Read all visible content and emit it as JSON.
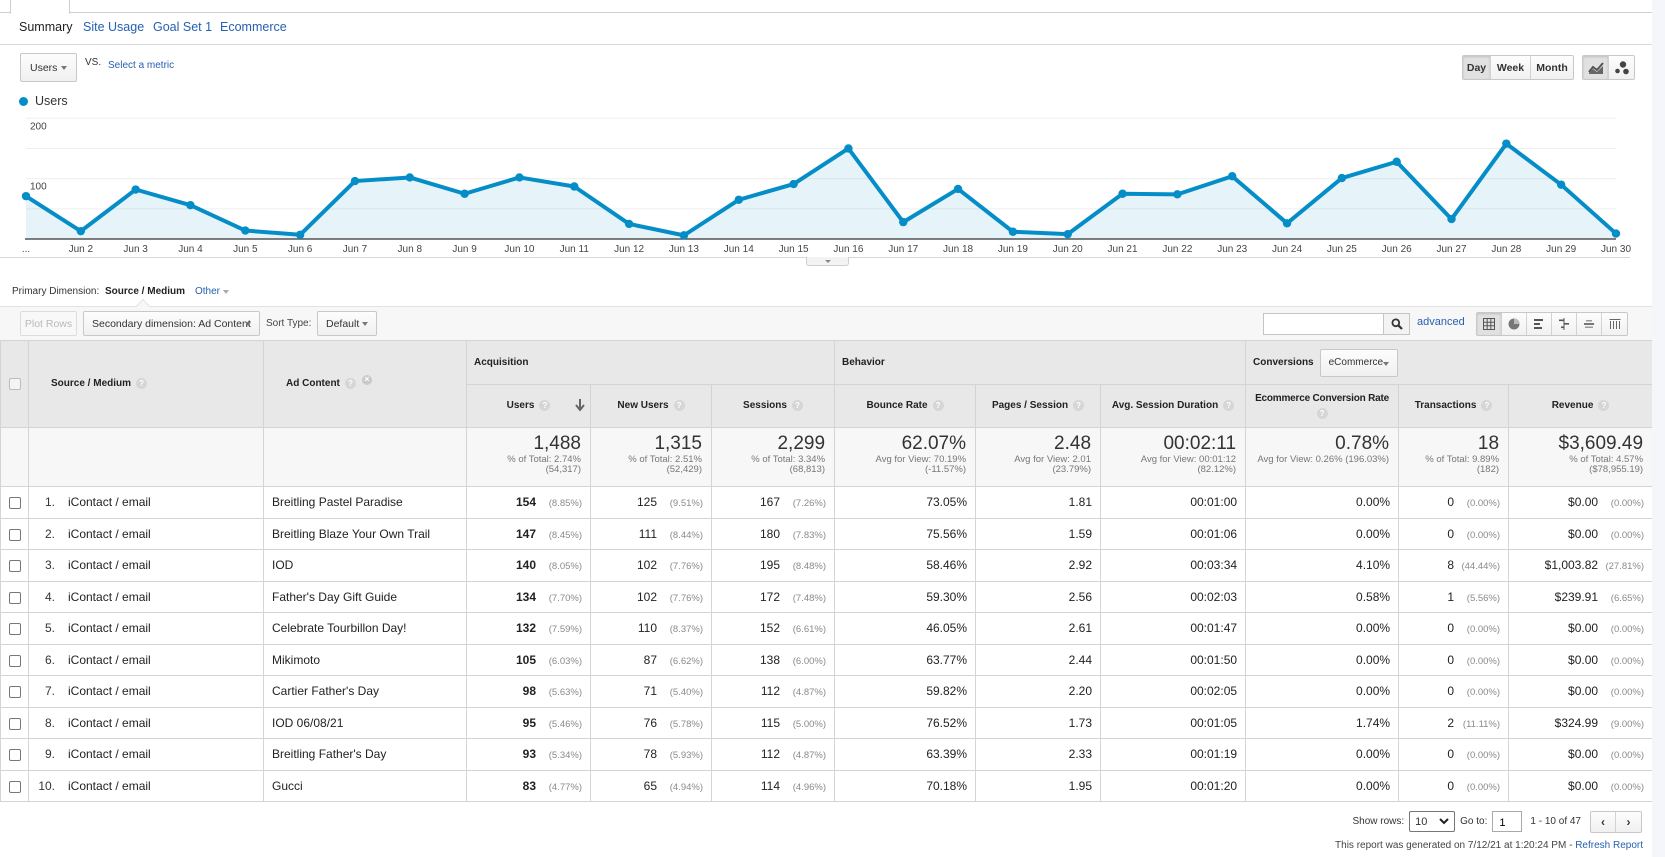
{
  "report_tabs": {
    "items": [
      "Summary",
      "Site Usage",
      "Goal Set 1",
      "Ecommerce"
    ],
    "active": "Summary"
  },
  "chart_controls": {
    "metric": "Users",
    "vs": "VS.",
    "select_metric": "Select a metric",
    "granularity": [
      "Day",
      "Week",
      "Month"
    ],
    "granularity_selected": "Day",
    "chart_types": [
      "line-chart-icon",
      "motion-chart-icon"
    ],
    "chart_type_selected": "line-chart-icon"
  },
  "chart_data": {
    "type": "line",
    "title": "",
    "legend": [
      "Users"
    ],
    "legend_position": "top-left",
    "x": [
      "...",
      "Jun 2",
      "Jun 3",
      "Jun 4",
      "Jun 5",
      "Jun 6",
      "Jun 7",
      "Jun 8",
      "Jun 9",
      "Jun 10",
      "Jun 11",
      "Jun 12",
      "Jun 13",
      "Jun 14",
      "Jun 15",
      "Jun 16",
      "Jun 17",
      "Jun 18",
      "Jun 19",
      "Jun 20",
      "Jun 21",
      "Jun 22",
      "Jun 23",
      "Jun 24",
      "Jun 25",
      "Jun 26",
      "Jun 27",
      "Jun 28",
      "Jun 29",
      "Jun 30"
    ],
    "series": [
      {
        "name": "Users",
        "values": [
          71,
          13,
          82,
          56,
          14,
          7,
          96,
          102,
          75,
          102,
          87,
          25,
          6,
          65,
          91,
          150,
          28,
          83,
          12,
          8,
          75,
          74,
          104,
          26,
          101,
          128,
          33,
          158,
          90,
          9
        ]
      }
    ],
    "xlabel": "",
    "ylabel": "",
    "ylim": [
      0,
      200
    ],
    "yticks": [
      100,
      200
    ],
    "y_gridlines": [
      50,
      100,
      150,
      200
    ],
    "grid": true,
    "color": "#058dc7",
    "fill_color": "#058dc7"
  },
  "dimension": {
    "label": "Primary Dimension:",
    "value": "Source / Medium",
    "other": "Other"
  },
  "toolbar": {
    "plot_rows": "Plot Rows",
    "secondary_dimension": "Secondary dimension: Ad Content",
    "sort_label": "Sort Type:",
    "sort_value": "Default",
    "search_value": "",
    "advanced": "advanced",
    "views": [
      "table-icon",
      "pie-chart-icon",
      "performance-icon",
      "comparison-icon",
      "term-cloud-icon",
      "pivot-icon"
    ],
    "view_selected": "table-icon"
  },
  "table": {
    "groups": {
      "acquisition": "Acquisition",
      "behavior": "Behavior",
      "conversions": "Conversions",
      "conversions_select": "eCommerce"
    },
    "columns": {
      "source_medium": "Source / Medium",
      "ad_content": "Ad Content",
      "users": "Users",
      "new_users": "New Users",
      "sessions": "Sessions",
      "bounce_rate": "Bounce Rate",
      "pages_session": "Pages / Session",
      "avg_session_duration": "Avg. Session Duration",
      "ecommerce_conversion_rate": "Ecommerce Conversion Rate",
      "transactions": "Transactions",
      "revenue": "Revenue"
    },
    "help_glyph": "?",
    "remove_glyph": "×",
    "sorted_by": "users",
    "totals": {
      "users": {
        "value": "1,488",
        "line1": "% of Total: 2.74%",
        "line2": "(54,317)"
      },
      "new_users": {
        "value": "1,315",
        "line1": "% of Total: 2.51%",
        "line2": "(52,429)"
      },
      "sessions": {
        "value": "2,299",
        "line1": "% of Total: 3.34%",
        "line2": "(68,813)"
      },
      "bounce_rate": {
        "value": "62.07%",
        "line1": "Avg for View: 70.19%",
        "line2": "(-11.57%)"
      },
      "pages_session": {
        "value": "2.48",
        "line1": "Avg for View: 2.01",
        "line2": "(23.79%)"
      },
      "avg_session_duration": {
        "value": "00:02:11",
        "line1": "Avg for View: 00:01:12",
        "line2": "(82.12%)"
      },
      "ecommerce_conversion_rate": {
        "value": "0.78%",
        "line1": "Avg for View: 0.26% (196.03%)"
      },
      "transactions": {
        "value": "18",
        "line1": "% of Total: 9.89%",
        "line2": "(182)"
      },
      "revenue": {
        "value": "$3,609.49",
        "line1": "% of Total: 4.57%",
        "line2": "($78,955.19)"
      }
    },
    "rows": [
      {
        "index": "1.",
        "source_medium": "iContact / email",
        "ad_content": "Breitling Pastel Paradise",
        "users": "154",
        "users_pct": "(8.85%)",
        "new_users": "125",
        "new_users_pct": "(9.51%)",
        "sessions": "167",
        "sessions_pct": "(7.26%)",
        "bounce_rate": "73.05%",
        "pages_session": "1.81",
        "avg_session_duration": "00:01:00",
        "ecommerce_conversion_rate": "0.00%",
        "transactions": "0",
        "transactions_pct": "(0.00%)",
        "revenue": "$0.00",
        "revenue_pct": "(0.00%)"
      },
      {
        "index": "2.",
        "source_medium": "iContact / email",
        "ad_content": "Breitling Blaze Your Own Trail",
        "users": "147",
        "users_pct": "(8.45%)",
        "new_users": "111",
        "new_users_pct": "(8.44%)",
        "sessions": "180",
        "sessions_pct": "(7.83%)",
        "bounce_rate": "75.56%",
        "pages_session": "1.59",
        "avg_session_duration": "00:01:06",
        "ecommerce_conversion_rate": "0.00%",
        "transactions": "0",
        "transactions_pct": "(0.00%)",
        "revenue": "$0.00",
        "revenue_pct": "(0.00%)"
      },
      {
        "index": "3.",
        "source_medium": "iContact / email",
        "ad_content": "IOD",
        "users": "140",
        "users_pct": "(8.05%)",
        "new_users": "102",
        "new_users_pct": "(7.76%)",
        "sessions": "195",
        "sessions_pct": "(8.48%)",
        "bounce_rate": "58.46%",
        "pages_session": "2.92",
        "avg_session_duration": "00:03:34",
        "ecommerce_conversion_rate": "4.10%",
        "transactions": "8",
        "transactions_pct": "(44.44%)",
        "revenue": "$1,003.82",
        "revenue_pct": "(27.81%)"
      },
      {
        "index": "4.",
        "source_medium": "iContact / email",
        "ad_content": "Father's Day Gift Guide",
        "users": "134",
        "users_pct": "(7.70%)",
        "new_users": "102",
        "new_users_pct": "(7.76%)",
        "sessions": "172",
        "sessions_pct": "(7.48%)",
        "bounce_rate": "59.30%",
        "pages_session": "2.56",
        "avg_session_duration": "00:02:03",
        "ecommerce_conversion_rate": "0.58%",
        "transactions": "1",
        "transactions_pct": "(5.56%)",
        "revenue": "$239.91",
        "revenue_pct": "(6.65%)"
      },
      {
        "index": "5.",
        "source_medium": "iContact / email",
        "ad_content": "Celebrate Tourbillon Day!",
        "users": "132",
        "users_pct": "(7.59%)",
        "new_users": "110",
        "new_users_pct": "(8.37%)",
        "sessions": "152",
        "sessions_pct": "(6.61%)",
        "bounce_rate": "46.05%",
        "pages_session": "2.61",
        "avg_session_duration": "00:01:47",
        "ecommerce_conversion_rate": "0.00%",
        "transactions": "0",
        "transactions_pct": "(0.00%)",
        "revenue": "$0.00",
        "revenue_pct": "(0.00%)"
      },
      {
        "index": "6.",
        "source_medium": "iContact / email",
        "ad_content": "Mikimoto",
        "users": "105",
        "users_pct": "(6.03%)",
        "new_users": "87",
        "new_users_pct": "(6.62%)",
        "sessions": "138",
        "sessions_pct": "(6.00%)",
        "bounce_rate": "63.77%",
        "pages_session": "2.44",
        "avg_session_duration": "00:01:50",
        "ecommerce_conversion_rate": "0.00%",
        "transactions": "0",
        "transactions_pct": "(0.00%)",
        "revenue": "$0.00",
        "revenue_pct": "(0.00%)"
      },
      {
        "index": "7.",
        "source_medium": "iContact / email",
        "ad_content": "Cartier Father's Day",
        "users": "98",
        "users_pct": "(5.63%)",
        "new_users": "71",
        "new_users_pct": "(5.40%)",
        "sessions": "112",
        "sessions_pct": "(4.87%)",
        "bounce_rate": "59.82%",
        "pages_session": "2.20",
        "avg_session_duration": "00:02:05",
        "ecommerce_conversion_rate": "0.00%",
        "transactions": "0",
        "transactions_pct": "(0.00%)",
        "revenue": "$0.00",
        "revenue_pct": "(0.00%)"
      },
      {
        "index": "8.",
        "source_medium": "iContact / email",
        "ad_content": "IOD 06/08/21",
        "users": "95",
        "users_pct": "(5.46%)",
        "new_users": "76",
        "new_users_pct": "(5.78%)",
        "sessions": "115",
        "sessions_pct": "(5.00%)",
        "bounce_rate": "76.52%",
        "pages_session": "1.73",
        "avg_session_duration": "00:01:05",
        "ecommerce_conversion_rate": "1.74%",
        "transactions": "2",
        "transactions_pct": "(11.11%)",
        "revenue": "$324.99",
        "revenue_pct": "(9.00%)"
      },
      {
        "index": "9.",
        "source_medium": "iContact / email",
        "ad_content": "Breitling Father's Day",
        "users": "93",
        "users_pct": "(5.34%)",
        "new_users": "78",
        "new_users_pct": "(5.93%)",
        "sessions": "112",
        "sessions_pct": "(4.87%)",
        "bounce_rate": "63.39%",
        "pages_session": "2.33",
        "avg_session_duration": "00:01:19",
        "ecommerce_conversion_rate": "0.00%",
        "transactions": "0",
        "transactions_pct": "(0.00%)",
        "revenue": "$0.00",
        "revenue_pct": "(0.00%)"
      },
      {
        "index": "10.",
        "source_medium": "iContact / email",
        "ad_content": "Gucci",
        "users": "83",
        "users_pct": "(4.77%)",
        "new_users": "65",
        "new_users_pct": "(4.94%)",
        "sessions": "114",
        "sessions_pct": "(4.96%)",
        "bounce_rate": "70.18%",
        "pages_session": "1.95",
        "avg_session_duration": "00:01:20",
        "ecommerce_conversion_rate": "0.00%",
        "transactions": "0",
        "transactions_pct": "(0.00%)",
        "revenue": "$0.00",
        "revenue_pct": "(0.00%)"
      }
    ]
  },
  "footer": {
    "show_rows_label": "Show rows:",
    "show_rows_value": "10",
    "goto_label": "Go to:",
    "goto_value": "1",
    "range": "1 - 10 of 47",
    "prev_glyph": "‹",
    "next_glyph": "›",
    "report_note": "This report was generated on 7/12/21 at 1:20:24 PM - ",
    "refresh": "Refresh Report"
  }
}
